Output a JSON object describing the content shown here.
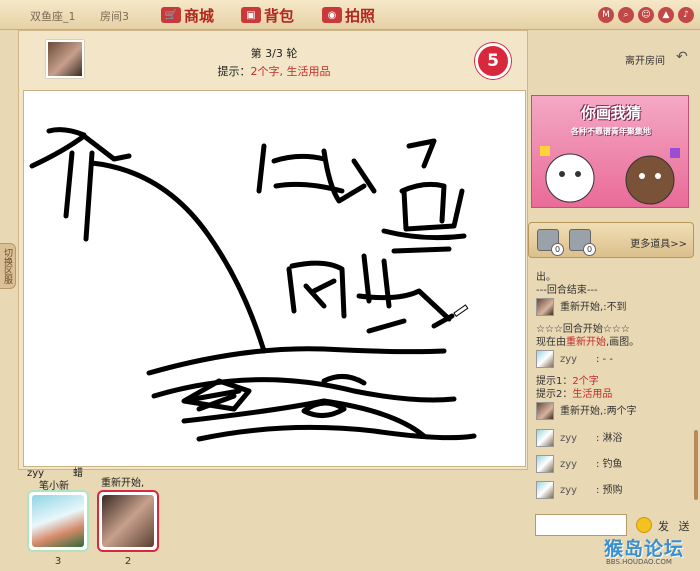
{
  "topbar": {
    "room_name": "双鱼座_1",
    "room_no": "房间3",
    "nav": [
      {
        "label": "商城",
        "icon": "cart-icon"
      },
      {
        "label": "背包",
        "icon": "backpack-icon"
      },
      {
        "label": "拍照",
        "icon": "camera-icon"
      }
    ],
    "icons": [
      "mobile-icon",
      "search-icon",
      "user-icon",
      "upload-icon",
      "volume-icon"
    ]
  },
  "side_tab": {
    "label": "切换区服"
  },
  "game": {
    "round": "第 3/3 轮",
    "hint_prefix": "提示：",
    "hint_text": "2个字, 生活用品",
    "timer": "5"
  },
  "players": [
    {
      "name_top": "zyy",
      "name_right": "蜡",
      "name_line2": "笔小新",
      "score": "3"
    },
    {
      "name": "重新开始,",
      "score": "2"
    }
  ],
  "right": {
    "leave_label": "离开房间",
    "banner_title": "你画我猜",
    "banner_sub": "各种不靠谱青年聚集地",
    "more_props": "更多道具>>",
    "prop_counts": [
      "0",
      "0"
    ]
  },
  "chat": {
    "lines": [
      {
        "type": "text",
        "text": "出。"
      },
      {
        "type": "text",
        "text": "---回合结束---"
      },
      {
        "type": "user",
        "name": "重新开始,",
        "msg": "不到"
      },
      {
        "type": "text",
        "text": "☆☆☆回合开始☆☆☆"
      },
      {
        "type": "text",
        "pre": "现在由",
        "red": "重新开始",
        "post": ",画图。"
      },
      {
        "type": "user2",
        "name": "zyy",
        "msg": ": - -"
      },
      {
        "type": "text",
        "pre": "提示1：",
        "red": "2个字",
        "post": ""
      },
      {
        "type": "text",
        "pre": "提示2：",
        "red": "生活用品",
        "post": ""
      },
      {
        "type": "user",
        "name": "重新开始,",
        "msg": "两个字"
      },
      {
        "type": "user2",
        "name": "zyy",
        "msg": ": 淋浴"
      },
      {
        "type": "user2",
        "name": "zyy",
        "msg": ": 钓鱼"
      },
      {
        "type": "user2",
        "name": "zyy",
        "msg": ": 预购"
      }
    ],
    "send_label": "发 送"
  },
  "watermark": {
    "text": "猴岛论坛",
    "url": "BBS.HOUDAO.COM"
  },
  "colors": {
    "accent_red": "#c42a2a",
    "timer": "#d8283c",
    "panel_bg": "#f3e6c8"
  }
}
